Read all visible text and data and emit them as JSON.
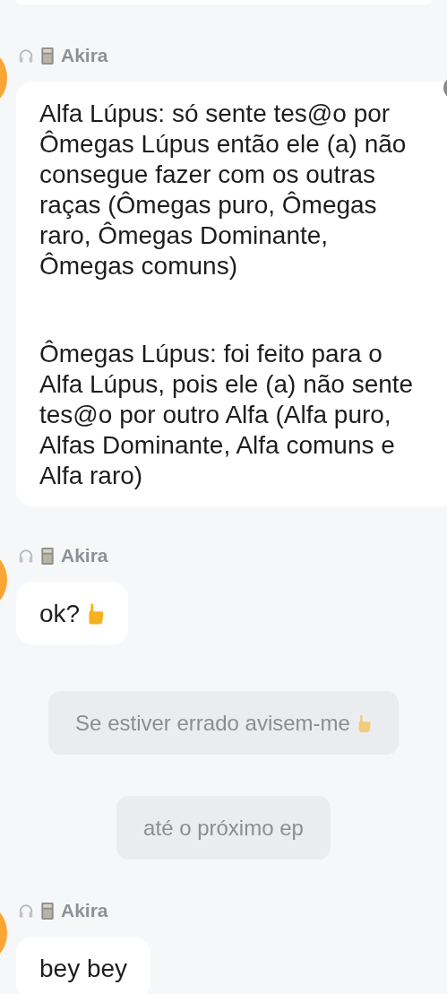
{
  "messages": [
    {
      "kind": "chat",
      "sender": "Akira",
      "paragraphs": [
        "Alfa Lúpus: só sente tes@o por Ômegas Lúpus então ele (a) não consegue fazer com os outras raças (Ômegas puro, Ômegas raro, Ômegas Dominante, Ômegas comuns)",
        "Ômegas Lúpus: foi feito para o Alfa Lúpus, pois ele (a) não sente tes@o por outro Alfa (Alfa puro, Alfas Dominante, Alfa comuns e Alfa raro)"
      ],
      "thumb_icon": false,
      "wide": true
    },
    {
      "kind": "chat",
      "sender": "Akira",
      "paragraphs": [
        "ok?"
      ],
      "thumb_icon": true,
      "wide": false
    },
    {
      "kind": "notice",
      "text": "Se estiver errado avisem-me",
      "thumb_icon": true
    },
    {
      "kind": "notice",
      "text": "até o próximo ep",
      "thumb_icon": false
    },
    {
      "kind": "chat",
      "sender": "Akira",
      "paragraphs": [
        "bey bey"
      ],
      "thumb_icon": false,
      "wide": false
    }
  ]
}
